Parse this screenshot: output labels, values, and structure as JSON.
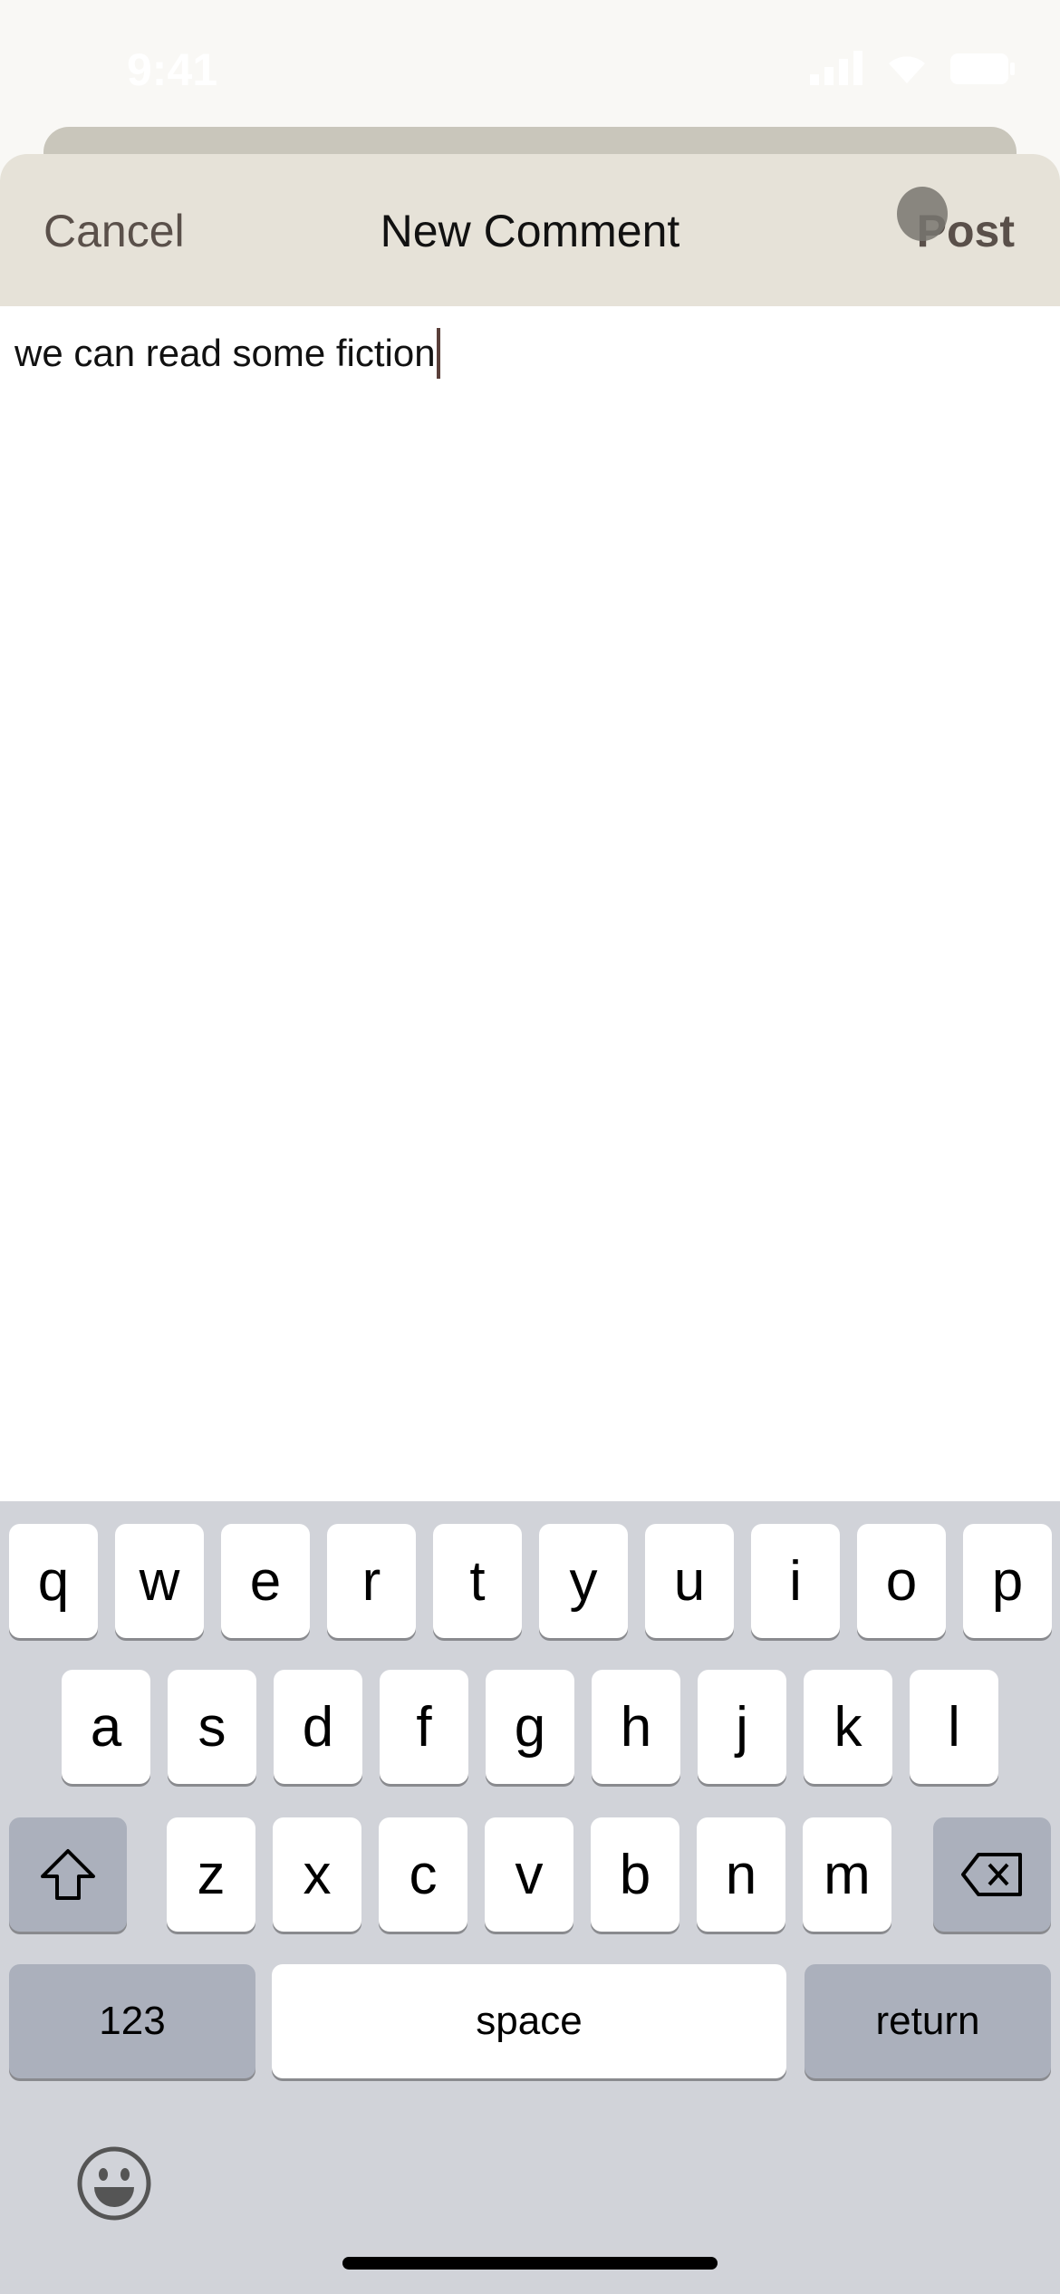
{
  "status_bar": {
    "time": "9:41",
    "icons": [
      "signal-icon",
      "wifi-icon",
      "battery-icon"
    ]
  },
  "header": {
    "cancel_label": "Cancel",
    "title": "New Comment",
    "post_label": "Post"
  },
  "comment": {
    "value": "we can read some fiction"
  },
  "keyboard": {
    "row1": [
      "q",
      "w",
      "e",
      "r",
      "t",
      "y",
      "u",
      "i",
      "o",
      "p"
    ],
    "row2": [
      "a",
      "s",
      "d",
      "f",
      "g",
      "h",
      "j",
      "k",
      "l"
    ],
    "row3": [
      "z",
      "x",
      "c",
      "v",
      "b",
      "n",
      "m"
    ],
    "numbers_label": "123",
    "space_label": "space",
    "return_label": "return",
    "icons": [
      "shift-icon",
      "delete-icon",
      "emoji-icon"
    ]
  },
  "colors": {
    "header_bg": "#e6e2d8",
    "accent_text": "#5a504a",
    "keyboard_bg": "#d1d3d9"
  }
}
